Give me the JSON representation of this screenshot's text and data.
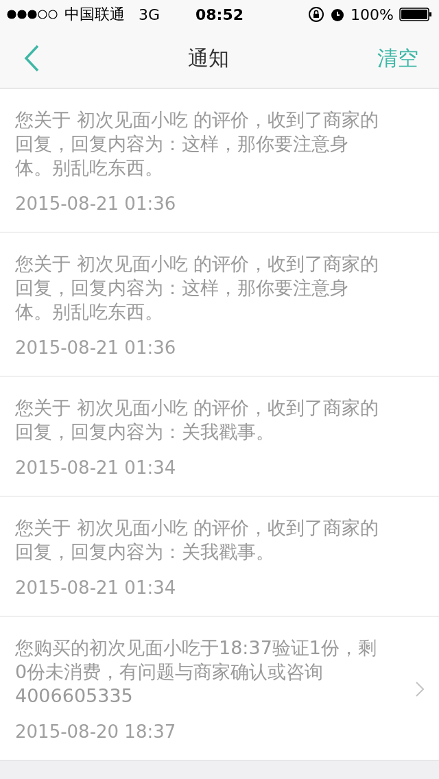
{
  "status_bar": {
    "carrier": "中国联通",
    "network": "3G",
    "time": "08:52",
    "battery": "100%"
  },
  "nav_bar": {
    "title": "通知",
    "action": "清空"
  },
  "notifications": [
    {
      "text": "您关于 初次见面小吃 的评价，收到了商家的回复，回复内容为：这样，那你要注意身体。别乱吃东西。",
      "time": "2015-08-21 01:36",
      "chevron": false
    },
    {
      "text": "您关于 初次见面小吃 的评价，收到了商家的回复，回复内容为：这样，那你要注意身体。别乱吃东西。",
      "time": "2015-08-21 01:36",
      "chevron": false
    },
    {
      "text": "您关于 初次见面小吃 的评价，收到了商家的回复，回复内容为：关我戳事。",
      "time": "2015-08-21 01:34",
      "chevron": false
    },
    {
      "text": "您关于 初次见面小吃 的评价，收到了商家的回复，回复内容为：关我戳事。",
      "time": "2015-08-21 01:34",
      "chevron": false
    },
    {
      "text": "您购买的初次见面小吃于18:37验证1份，剩0份未消费，有问题与商家确认或咨询4006605335",
      "time": "2015-08-20 18:37",
      "chevron": true
    }
  ]
}
